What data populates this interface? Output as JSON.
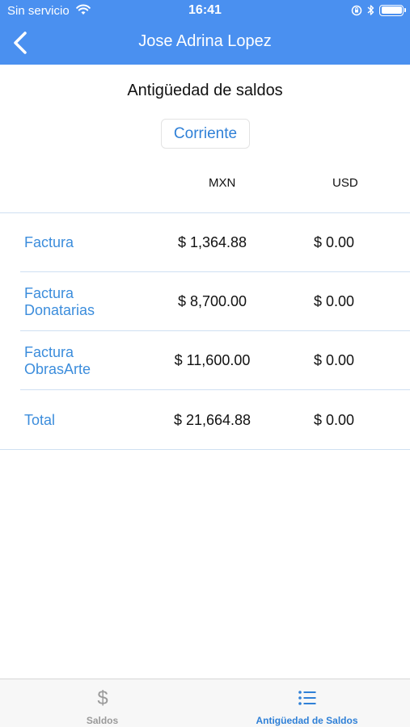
{
  "status_bar": {
    "carrier": "Sin servicio",
    "time": "16:41",
    "wifi_icon": "wifi-icon",
    "battery_icon": "battery-icon"
  },
  "nav": {
    "title": "Jose Adrina Lopez",
    "back_icon": "chevron-left-icon"
  },
  "main": {
    "heading": "Antigüedad de saldos",
    "segment": "Corriente",
    "columns": [
      "MXN",
      "USD"
    ],
    "rows": [
      {
        "label": "Factura",
        "mxn": "$ 1,364.88",
        "usd": "$ 0.00"
      },
      {
        "label": "Factura Donatarias",
        "mxn": "$ 8,700.00",
        "usd": "$ 0.00"
      },
      {
        "label": "Factura ObrasArte",
        "mxn": "$ 11,600.00",
        "usd": "$ 0.00"
      },
      {
        "label": "Total",
        "mxn": "$ 21,664.88",
        "usd": "$ 0.00"
      }
    ]
  },
  "tabbar": {
    "tabs": [
      {
        "label": "Saldos",
        "icon": "dollar-icon",
        "active": false
      },
      {
        "label": "Antigüedad de Saldos",
        "icon": "list-icon",
        "active": true
      }
    ]
  },
  "colors": {
    "nav_bg": "#4a90f0",
    "accent": "#2f80d7",
    "label_blue": "#3c8ddc",
    "separator": "#cfe0f2"
  }
}
